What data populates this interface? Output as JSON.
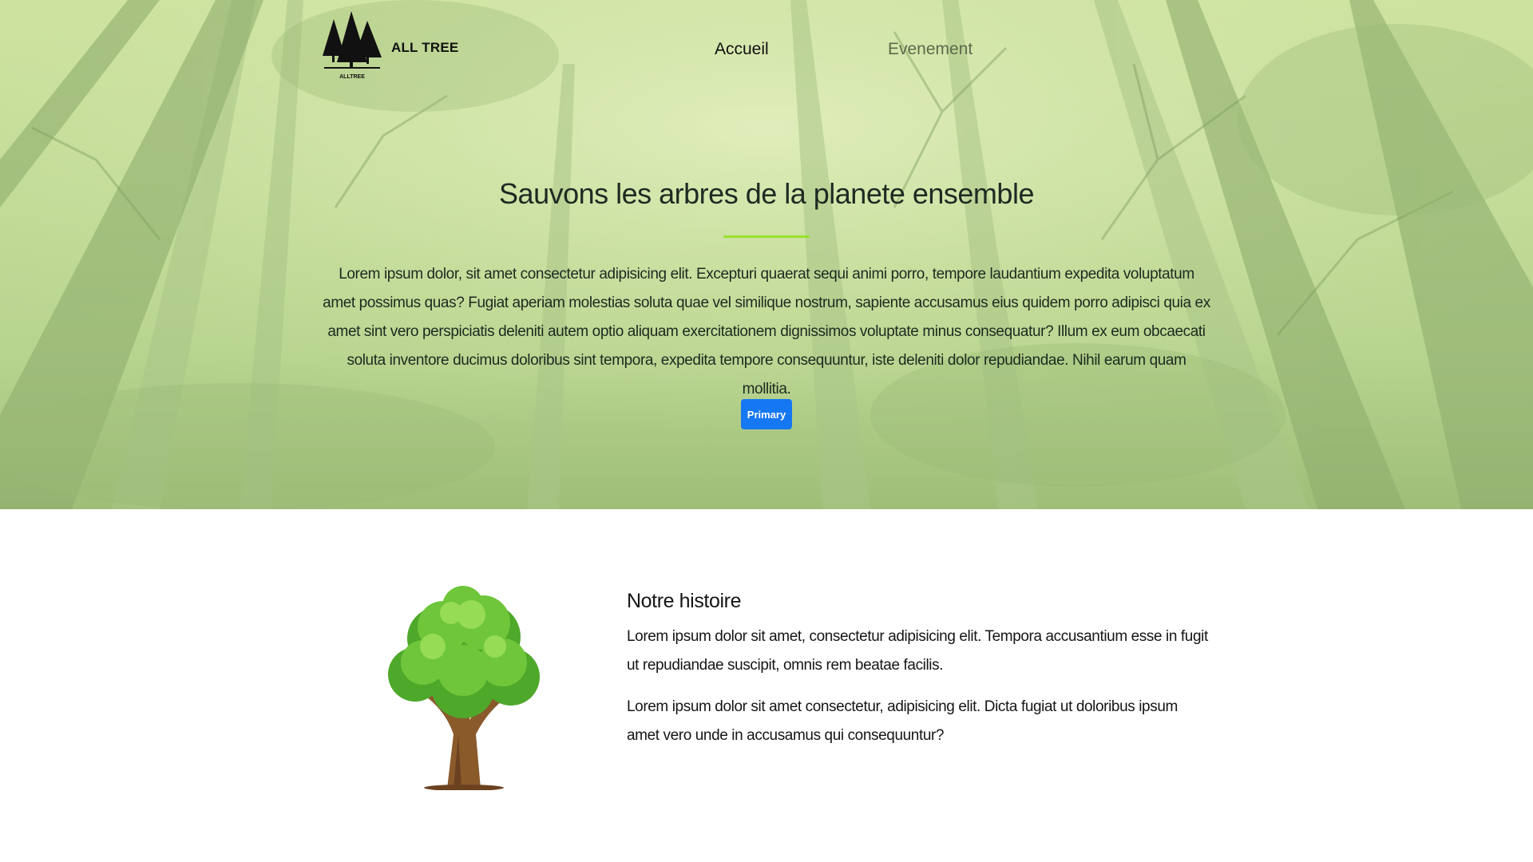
{
  "header": {
    "brand": "ALL TREE",
    "logo_text": "ALLTREE",
    "nav": [
      {
        "label": "Accueil",
        "active": true
      },
      {
        "label": "Evenement",
        "active": false
      }
    ]
  },
  "hero": {
    "title": "Sauvons les arbres de la planete ensemble",
    "text": "Lorem ipsum dolor, sit amet consectetur adipisicing elit. Excepturi quaerat sequi animi porro, tempore laudantium expedita voluptatum amet possimus quas? Fugiat aperiam molestias soluta quae vel similique nostrum, sapiente accusamus eius quidem porro adipisci quia ex amet sint vero perspiciatis deleniti autem optio aliquam exercitationem dignissimos voluptate minus consequatur? Illum ex eum obcaecati soluta inventore ducimus doloribus sint tempora, expedita tempore consequuntur, iste deleniti dolor repudiandae. Nihil earum quam mollitia.",
    "button_label": "Primary"
  },
  "story": {
    "title": "Notre histoire",
    "paragraphs": [
      "Lorem ipsum dolor sit amet, consectetur adipisicing elit. Tempora accusantium esse in fugit ut repudiandae suscipit, omnis rem beatae facilis.",
      "Lorem ipsum dolor sit amet consectetur, adipisicing elit. Dicta fugiat ut doloribus ipsum amet vero unde in accusamus qui consequuntur?"
    ]
  },
  "colors": {
    "accent_rule": "#97e22c",
    "primary_button": "#1677f2",
    "hero_tint": "#c3dc98"
  },
  "icons": [
    "pine-trees-logo-icon",
    "tree-illustration"
  ]
}
